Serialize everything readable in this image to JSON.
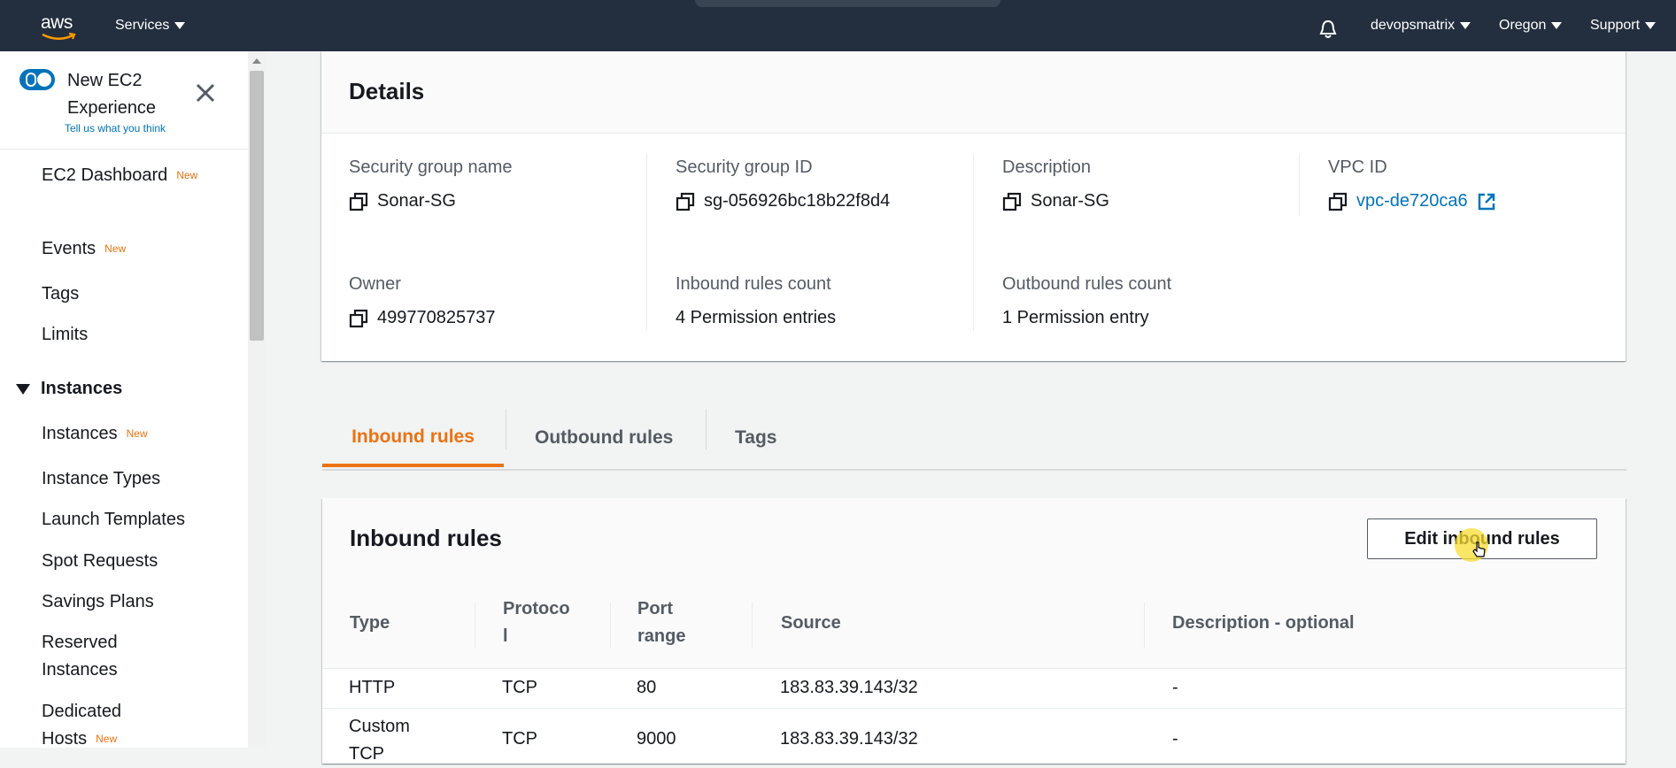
{
  "topnav": {
    "logo": "aws",
    "services_label": "Services",
    "account_label": "devopsmatrix",
    "region_label": "Oregon",
    "support_label": "Support"
  },
  "sidebar": {
    "new_experience_label": "New EC2 Experience",
    "feedback_link": "Tell us what you think",
    "items": [
      {
        "label": "EC2 Dashboard",
        "badge": "New"
      },
      {
        "label": "Events",
        "badge": "New"
      },
      {
        "label": "Tags",
        "badge": ""
      },
      {
        "label": "Limits",
        "badge": ""
      }
    ],
    "instances_section": "Instances",
    "instances_items": [
      {
        "label": "Instances",
        "badge": "New"
      },
      {
        "label": "Instance Types",
        "badge": ""
      },
      {
        "label": "Launch Templates",
        "badge": ""
      },
      {
        "label": "Spot Requests",
        "badge": ""
      },
      {
        "label": "Savings Plans",
        "badge": ""
      },
      {
        "label": "Reserved Instances",
        "badge": ""
      },
      {
        "label": "Dedicated Hosts",
        "badge": "New"
      }
    ]
  },
  "details": {
    "title": "Details",
    "fields": {
      "sg_name": {
        "label": "Security group name",
        "value": "Sonar-SG"
      },
      "sg_id": {
        "label": "Security group ID",
        "value": "sg-056926bc18b22f8d4"
      },
      "description": {
        "label": "Description",
        "value": "Sonar-SG"
      },
      "vpc_id": {
        "label": "VPC ID",
        "value": "vpc-de720ca6"
      },
      "owner": {
        "label": "Owner",
        "value": "499770825737"
      },
      "inbound_count": {
        "label": "Inbound rules count",
        "value": "4 Permission entries"
      },
      "outbound_count": {
        "label": "Outbound rules count",
        "value": "1 Permission entry"
      }
    }
  },
  "tabs": [
    {
      "label": "Inbound rules",
      "active": true
    },
    {
      "label": "Outbound rules",
      "active": false
    },
    {
      "label": "Tags",
      "active": false
    }
  ],
  "inbound": {
    "title": "Inbound rules",
    "edit_button": "Edit inbound rules",
    "columns": {
      "type": "Type",
      "protocol_1": "Protoco",
      "protocol_2": "l",
      "port_1": "Port",
      "port_2": "range",
      "source": "Source",
      "description": "Description - optional"
    },
    "rows": [
      {
        "type": "HTTP",
        "type_2": "",
        "protocol": "TCP",
        "port": "80",
        "source": "183.83.39.143/32",
        "description": "-"
      },
      {
        "type": "Custom",
        "type_2": "TCP",
        "protocol": "TCP",
        "port": "9000",
        "source": "183.83.39.143/32",
        "description": "-"
      }
    ]
  },
  "colors": {
    "nav_bg": "#232f3e",
    "accent_orange": "#ec7211",
    "link_blue": "#0073bb"
  }
}
